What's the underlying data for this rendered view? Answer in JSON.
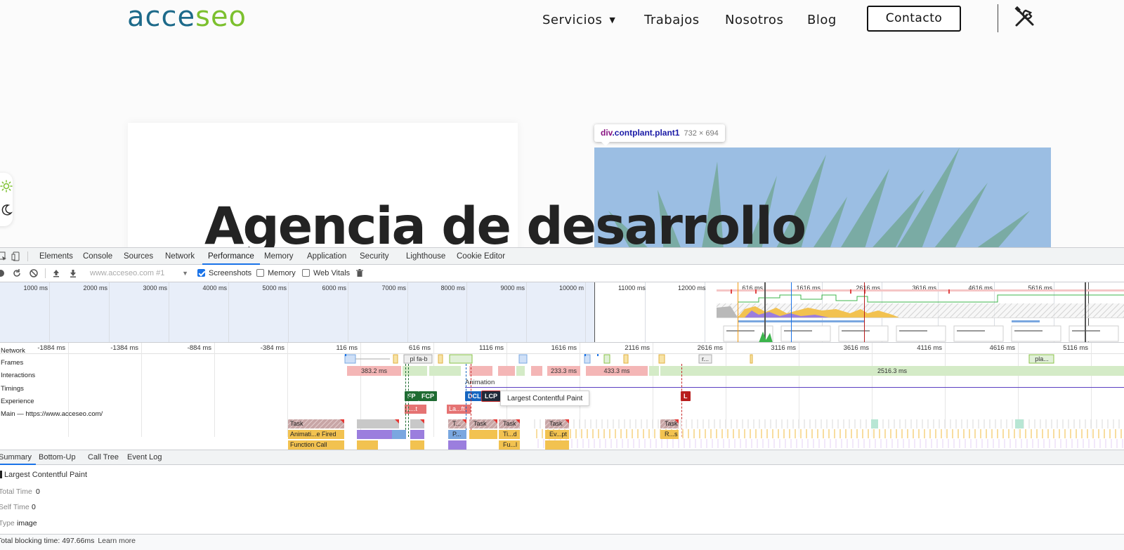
{
  "site": {
    "logo_part1": "acce",
    "logo_part2": "seo",
    "nav": {
      "servicios": "Servicios",
      "trabajos": "Trabajos",
      "nosotros": "Nosotros",
      "blog": "Blog",
      "contacto": "Contacto"
    },
    "hero_title": "Agencia de desarrollo",
    "inspect": {
      "tag": "div",
      "classes": ".contplant.plant1",
      "size": "732 × 694"
    }
  },
  "devtools": {
    "tabs": [
      "Elements",
      "Console",
      "Sources",
      "Network",
      "Performance",
      "Memory",
      "Application",
      "Security",
      "Lighthouse",
      "Cookie Editor"
    ],
    "active_tab": "Performance",
    "recording_select": "www.acceseo.com #1",
    "checkboxes": {
      "screenshots": "Screenshots",
      "screenshots_checked": true,
      "memory": "Memory",
      "memory_checked": false,
      "web_vitals": "Web Vitals",
      "web_vitals_checked": false
    },
    "overview_labels": [
      "1000 ms",
      "2000 ms",
      "3000 ms",
      "4000 ms",
      "5000 ms",
      "6000 ms",
      "7000 ms",
      "8000 ms",
      "9000 ms",
      "10000 m",
      "11000 ms",
      "12000 ms",
      "616 ms",
      "1616 ms",
      "2616 ms",
      "3616 ms",
      "4616 ms",
      "5616 ms"
    ],
    "ruler_labels": [
      "-1884 ms",
      "-1384 ms",
      "-884 ms",
      "-384 ms",
      "116 ms",
      "616 ms",
      "1116 ms",
      "1616 ms",
      "2116 ms",
      "2616 ms",
      "3116 ms",
      "3616 ms",
      "4116 ms",
      "4616 ms",
      "5116 ms"
    ],
    "tracks": {
      "network": "Network",
      "frames": "Frames",
      "interactions": "Interactions",
      "timings": "Timings",
      "experience": "Experience",
      "main": "Main — https://www.acceseo.com/"
    },
    "network_labels": {
      "pl_fa_b": "pl fa-b",
      "r": "r...",
      "pla": "pla..."
    },
    "frames": [
      "383.2 ms",
      "233.3 ms",
      "433.3 ms",
      "2516.3 ms"
    ],
    "interaction": "Animation",
    "timings": {
      "fp": "FP",
      "fcp": "FCP",
      "dcl": "DCL",
      "lcp": "LCP",
      "l": "L"
    },
    "experience": [
      "L...t",
      "La...ft"
    ],
    "lcp_tooltip": "Largest Contentful Paint",
    "main_tasks": {
      "row1": [
        "Task",
        "T...",
        "Task",
        "Task",
        "Task",
        "Task"
      ],
      "row2": [
        "Animati...e Fired",
        "P...",
        "Ti...d",
        "Ev...pt",
        "R...s"
      ],
      "row3": [
        "Function Call",
        "Fu...l"
      ]
    },
    "bottom_tabs": [
      "Summary",
      "Bottom-Up",
      "Call Tree",
      "Event Log"
    ],
    "summary": {
      "title": "Largest Contentful Paint",
      "total_time_label": "Total Time",
      "total_time": "0",
      "self_time_label": "Self Time",
      "self_time": "0",
      "type_label": "Type",
      "type": "image"
    },
    "footer": {
      "tbt": "Total blocking time: 497.66ms",
      "learn_more": "Learn more"
    }
  },
  "colors": {
    "logo_blue": "#1d6a8a",
    "logo_green": "#7cc02e",
    "fp": "#1e6b32",
    "dcl": "#1565c0",
    "lcp": "#1f2a3a",
    "l": "#b71c1c",
    "frame_red": "#f4b6b6",
    "frame_green": "#d4ebc7",
    "task_gray": "#c8c8c8",
    "animation_purple": "#9b7ede",
    "scripting_yellow": "#f2c250"
  }
}
